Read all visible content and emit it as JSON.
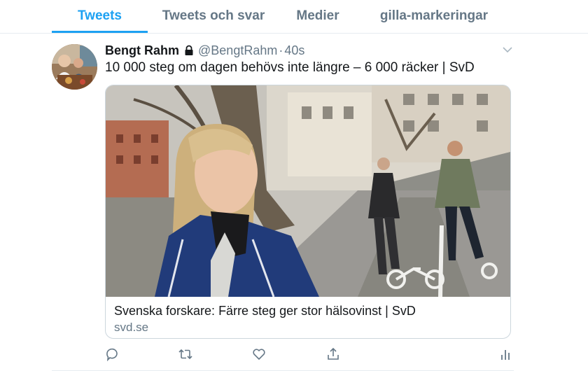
{
  "tabs": [
    {
      "label": "Tweets",
      "active": true
    },
    {
      "label": "Tweets och svar",
      "active": false
    },
    {
      "label": "Medier",
      "active": false
    },
    {
      "label": "gilla-markeringar",
      "active": false
    }
  ],
  "tweet": {
    "author_name": "Bengt Rahm",
    "protected_icon": "lock-icon",
    "handle": "@BengtRahm",
    "separator": "·",
    "time": "40s",
    "text": "10 000 steg om dagen behövs inte längre – 6 000 räcker | SvD",
    "card": {
      "title": "Svenska forskare: Färre steg ger stor hälsovinst | SvD",
      "domain": "svd.se"
    },
    "actions": [
      "reply-icon",
      "retweet-icon",
      "like-icon",
      "share-icon",
      "analytics-icon"
    ]
  },
  "colors": {
    "accent": "#1da1f2",
    "muted": "#657786",
    "text": "#14171a",
    "border": "#e6ecf0"
  }
}
